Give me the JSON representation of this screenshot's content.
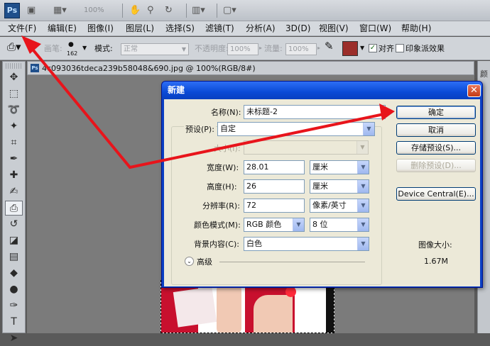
{
  "app": {
    "logo": "Ps",
    "zoom": "100%"
  },
  "menubar": {
    "items": [
      {
        "label": "文件(F)"
      },
      {
        "label": "编辑(E)"
      },
      {
        "label": "图像(I)"
      },
      {
        "label": "图层(L)"
      },
      {
        "label": "选择(S)"
      },
      {
        "label": "滤镜(T)"
      },
      {
        "label": "分析(A)"
      },
      {
        "label": "3D(D)"
      },
      {
        "label": "视图(V)"
      },
      {
        "label": "窗口(W)"
      },
      {
        "label": "帮助(H)"
      }
    ]
  },
  "options": {
    "brush_label": "画笔:",
    "brush_size": "162",
    "mode_label": "模式:",
    "mode_value": "正常",
    "opacity_label": "不透明度:",
    "opacity_value": "100%",
    "flow_label": "流量:",
    "flow_value": "100%",
    "align_label": "对齐",
    "impressionist_label": "印象派效果"
  },
  "document": {
    "title": "4c093036tdeca239b58048&690.jpg @ 100%(RGB/8#)"
  },
  "right_panel": {
    "label": "颜"
  },
  "dialog": {
    "title": "新建",
    "close": "✕",
    "name_label": "名称(N):",
    "name_value": "未标题-2",
    "preset_label": "预设(P):",
    "preset_value": "自定",
    "size_label": "大小(I):",
    "width_label": "宽度(W):",
    "width_value": "28.01",
    "width_unit": "厘米",
    "height_label": "高度(H):",
    "height_value": "26",
    "height_unit": "厘米",
    "resolution_label": "分辨率(R):",
    "resolution_value": "72",
    "resolution_unit": "像素/英寸",
    "color_mode_label": "颜色模式(M):",
    "color_mode_value": "RGB 颜色",
    "bit_depth_value": "8 位",
    "background_label": "背景内容(C):",
    "background_value": "白色",
    "advanced_label": "高级",
    "image_size_label": "图像大小:",
    "image_size_value": "1.67M",
    "buttons": {
      "ok": "确定",
      "cancel": "取消",
      "save_preset": "存储预设(S)...",
      "delete_preset": "删除预设(D)...",
      "device_central": "Device Central(E)..."
    }
  },
  "colors": {
    "arrow": "#e8141b",
    "dialog_title": "#0a4ad6",
    "dialog_body": "#ece9d8"
  }
}
